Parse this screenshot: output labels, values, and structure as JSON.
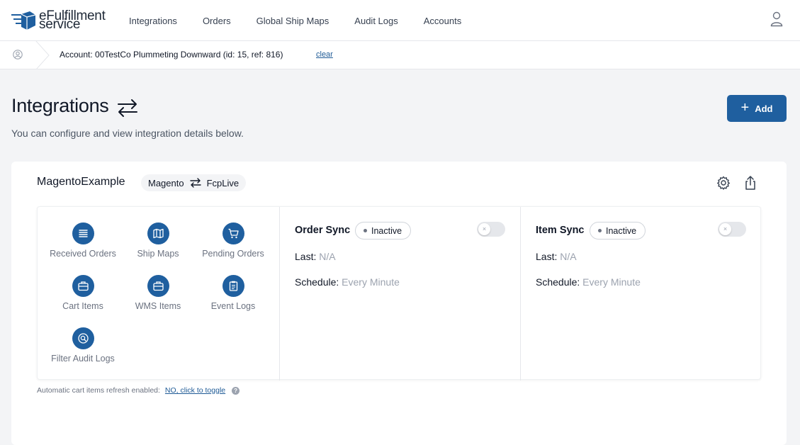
{
  "brand": {
    "line1": "eFulfillment",
    "line2": "service",
    "accent": "#1f5f9f"
  },
  "nav": {
    "items": [
      {
        "label": "Integrations"
      },
      {
        "label": "Orders"
      },
      {
        "label": "Global Ship Maps"
      },
      {
        "label": "Audit Logs"
      },
      {
        "label": "Accounts"
      }
    ]
  },
  "account_bar": {
    "text": "Account: 00TestCo Plummeting Downward (id: 15, ref: 816)",
    "clear_label": "clear"
  },
  "header": {
    "title": "Integrations",
    "subtitle": "You can configure and view integration details below.",
    "add_label": "Add"
  },
  "integration": {
    "name": "MagentoExample",
    "source": "Magento",
    "target": "FcpLive",
    "quick_actions": [
      {
        "label": "Received Orders",
        "icon": "list-icon"
      },
      {
        "label": "Ship Maps",
        "icon": "map-icon"
      },
      {
        "label": "Pending Orders",
        "icon": "cart-icon"
      },
      {
        "label": "Cart Items",
        "icon": "briefcase-icon"
      },
      {
        "label": "WMS Items",
        "icon": "briefcase-icon"
      },
      {
        "label": "Event Logs",
        "icon": "clipboard-icon"
      },
      {
        "label": "Filter Audit Logs",
        "icon": "search-icon"
      }
    ],
    "order_sync": {
      "title": "Order Sync",
      "status": "Inactive",
      "last_label": "Last:",
      "last_value": "N/A",
      "schedule_label": "Schedule:",
      "schedule_value": "Every Minute",
      "enabled": false
    },
    "item_sync": {
      "title": "Item Sync",
      "status": "Inactive",
      "last_label": "Last:",
      "last_value": "N/A",
      "schedule_label": "Schedule:",
      "schedule_value": "Every Minute",
      "enabled": false
    },
    "refresh_note": "Automatic cart items refresh enabled:",
    "refresh_toggle_label": "NO, click to toggle"
  }
}
